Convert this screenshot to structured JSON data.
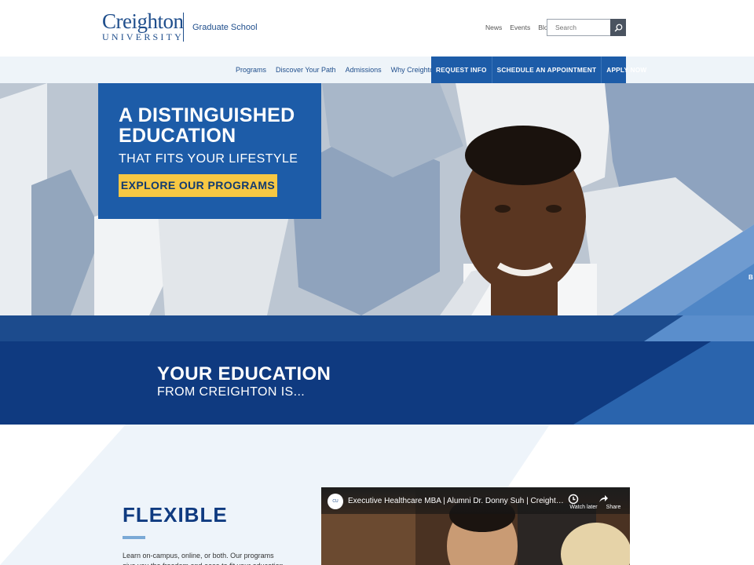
{
  "header": {
    "logo_word": "Creighton",
    "logo_sub": "UNIVERSITY",
    "school_name": "Graduate School",
    "util_links": [
      "News",
      "Events",
      "Blog"
    ],
    "search_placeholder": "Search"
  },
  "nav": {
    "links": [
      "Programs",
      "Discover Your Path",
      "Admissions",
      "Why Creighton"
    ],
    "cta": [
      "REQUEST INFO",
      "SCHEDULE AN APPOINTMENT",
      "APPLY NOW"
    ]
  },
  "hero": {
    "headline_line1": "A DISTINGUISHED",
    "headline_line2": "EDUCATION",
    "subheadline": "THAT FITS YOUR LIFESTYLE",
    "button": "EXPLORE OUR PROGRAMS",
    "edge_text": "B"
  },
  "band": {
    "headline": "YOUR EDUCATION",
    "subheadline": "FROM CREIGHTON IS..."
  },
  "feature": {
    "title": "FLEXIBLE",
    "body": "Learn on-campus, online, or both. Our programs give you the freedom and ease to fit your education into"
  },
  "video": {
    "title": "Executive Healthcare MBA | Alumni Dr. Donny Suh | Creighton Uni...",
    "watch_later": "Watch later",
    "share": "Share"
  },
  "colors": {
    "brand_blue": "#1d5ca8",
    "navy": "#0f3a80",
    "accent_yellow": "#f7c843"
  }
}
